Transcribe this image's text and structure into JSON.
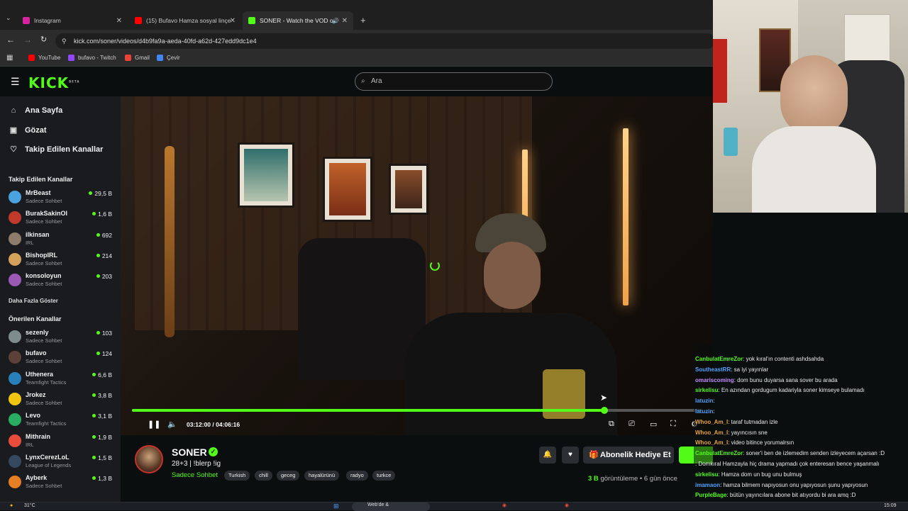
{
  "browser": {
    "tabs": [
      {
        "label": "Instagram",
        "color": "#d6249f"
      },
      {
        "label": "(15) Bufavo Hamza sosyal linçe",
        "color": "#ff0000"
      },
      {
        "label": "SONER - Watch the VOD o",
        "color": "#53fc18"
      }
    ],
    "new_tab": "+",
    "url": "kick.com/soner/videos/d4b9fa9a-aeda-40fd-a62d-427edd9dc1e4",
    "bookmarks": [
      "YouTube",
      "bufavo - Twitch",
      "Gmail",
      "Çevir"
    ]
  },
  "header": {
    "logo": "KICK",
    "logo_badge": "BETA",
    "search_placeholder": "Ara"
  },
  "sidebar": {
    "nav": [
      "Ana Sayfa",
      "Gözat",
      "Takip Edilen Kanallar"
    ],
    "followed_heading": "Takip Edilen Kanallar",
    "followed": [
      {
        "name": "MrBeast",
        "category": "Sadece Sohbet",
        "viewers": "29,5 B",
        "color": "#4aa3df"
      },
      {
        "name": "BurakSakinOl",
        "category": "Sadece Sohbet",
        "viewers": "1,6 B",
        "color": "#c0392b"
      },
      {
        "name": "ilkinsan",
        "category": "IRL",
        "viewers": "692",
        "color": "#8e7b6b"
      },
      {
        "name": "BishopIRL",
        "category": "Sadece Sohbet",
        "viewers": "214",
        "color": "#d3a15c"
      },
      {
        "name": "konsoloyun",
        "category": "Sadece Sohbet",
        "viewers": "203",
        "color": "#9b59b6"
      }
    ],
    "show_more": "Daha Fazla Göster",
    "recommended_heading": "Önerilen Kanallar",
    "recommended": [
      {
        "name": "sezenly",
        "category": "Sadece Sohbet",
        "viewers": "103",
        "color": "#7f8c8d"
      },
      {
        "name": "bufavo",
        "category": "Sadece Sohbet",
        "viewers": "124",
        "color": "#5d4037"
      },
      {
        "name": "Uthenera",
        "category": "Teamfight Tactics",
        "viewers": "6,6 B",
        "color": "#2980b9"
      },
      {
        "name": "Jrokez",
        "category": "Sadece Sohbet",
        "viewers": "3,8 B",
        "color": "#f1c40f"
      },
      {
        "name": "Levo",
        "category": "Teamfight Tactics",
        "viewers": "3,1 B",
        "color": "#27ae60"
      },
      {
        "name": "Mithrain",
        "category": "IRL",
        "viewers": "1,9 B",
        "color": "#e74c3c"
      },
      {
        "name": "LynxCerezLoL",
        "category": "League of Legends",
        "viewers": "1,5 B",
        "color": "#34495e"
      },
      {
        "name": "Ayberk",
        "category": "Sadece Sohbet",
        "viewers": "1,3 B",
        "color": "#e67e22"
      }
    ]
  },
  "player": {
    "time": "03:12:00 / 04:06:16",
    "progress": 0.83
  },
  "channel": {
    "name": "SONER",
    "title": "28+3 | !blerp !ig",
    "category": "Sadece Sohbet",
    "tags": [
      "Turkish",
      "chill",
      "geceg",
      "hayalürünü",
      "radyo",
      "turkce"
    ],
    "gift_label": "Abonelik Hediye Et",
    "views_count": "3 B",
    "views_label": "görüntüleme",
    "age": "6 gün önce"
  },
  "chat": [
    {
      "user": "CanbulatEmreZor",
      "text": ": yok kıral'ın contenti ashdsahda",
      "color": "#53fc18"
    },
    {
      "user": "SoutheastRR",
      "text": ": sa iyi yayınlar",
      "color": "#4fa3ff"
    },
    {
      "user": "omariscoming",
      "text": ": dom bunu duyarsa sana sover bu arada",
      "color": "#c58cff"
    },
    {
      "user": "sirkelisu",
      "text": ": En azından gordugum kadariyla soner kimseye bulamadı",
      "color": "#53fc18"
    },
    {
      "user": "latuzin",
      "text": ":",
      "color": "#4fa3ff"
    },
    {
      "user": "latuzin",
      "text": ":",
      "color": "#4fa3ff"
    },
    {
      "user": "Whoo_Am_I",
      "text": ": taraf tutmadan izle",
      "color": "#e6a23c"
    },
    {
      "user": "Whoo_Am_I",
      "text": ": yayıncısın sne",
      "color": "#e6a23c"
    },
    {
      "user": "Whoo_Am_I",
      "text": ": video bitince yorumalrsın",
      "color": "#e6a23c"
    },
    {
      "user": "CanbulatEmreZor",
      "text": ": soner'i ben de izlemedim senden izleyecem açarsan :D",
      "color": "#53fc18"
    },
    {
      "user": "",
      "text": ": Domkıral Hamzayla hiç drama yapmadı çok enteresan bence yaşanmalı",
      "color": "#ff5a5a"
    },
    {
      "user": "sirkelisu",
      "text": ": Hamza dom un bug unu bulmuş",
      "color": "#53fc18"
    },
    {
      "user": "imamaon",
      "text": ": hamza bilmem napıyosun onu yapıyosun şunu yapıyosun",
      "color": "#4fa3ff"
    },
    {
      "user": "PurpleBage",
      "text": ": bütün yayıncılara abone bit atıyordu bi ara amq :D",
      "color": "#53fc18"
    }
  ],
  "taskbar": {
    "weather": "31°C",
    "search": "Web'de &",
    "clock": "15:09"
  }
}
